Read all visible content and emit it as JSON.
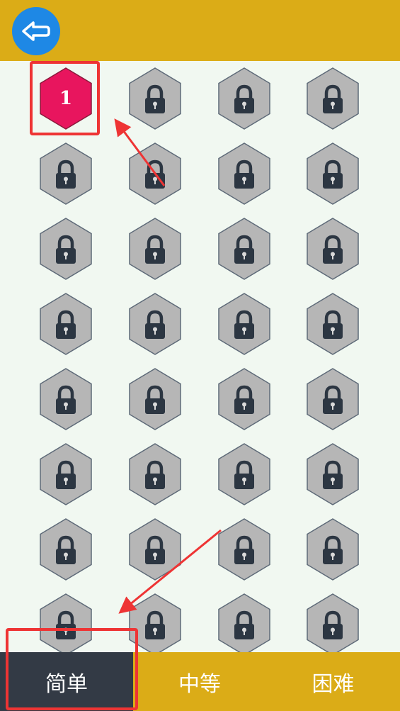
{
  "header": {
    "back_icon": "back-arrow-icon"
  },
  "levels": {
    "unlocked_label": "1",
    "unlocked_color": "#e8155e",
    "locked_color": "#b6b6b6",
    "locked_icon": "lock-icon",
    "rows": 8,
    "cols": 4
  },
  "tabs": [
    {
      "label": "简单",
      "active": true
    },
    {
      "label": "中等",
      "active": false
    },
    {
      "label": "困难",
      "active": false
    }
  ],
  "colors": {
    "header_bg": "#dbac17",
    "page_bg": "#f1f8f1",
    "active_tab_bg": "#333a45",
    "annotation": "#ee3434"
  }
}
